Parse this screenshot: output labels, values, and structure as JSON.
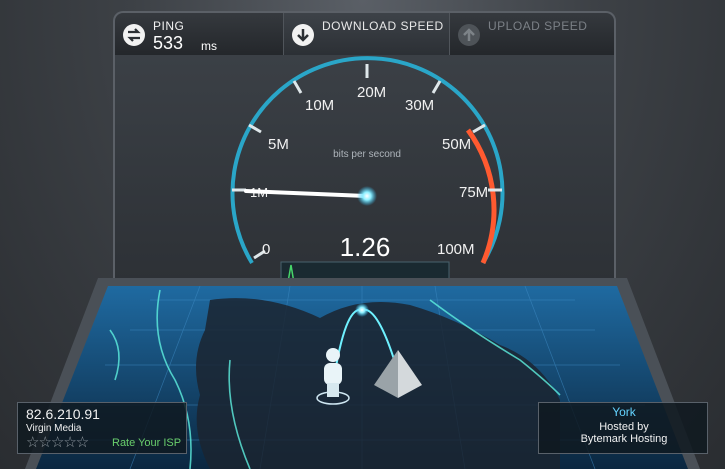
{
  "header": {
    "ping_label": "PING",
    "ping_value": "533",
    "ping_unit": "ms",
    "download_label": "DOWNLOAD SPEED",
    "upload_label": "UPLOAD SPEED"
  },
  "gauge": {
    "unit_label": "bits per second",
    "current_value": "1.26",
    "scale_labels": [
      "0",
      "1M",
      "5M",
      "10M",
      "20M",
      "30M",
      "50M",
      "75M",
      "100M"
    ]
  },
  "client": {
    "ip": "82.6.210.91",
    "isp": "Virgin Media",
    "rating_stars": "☆☆☆☆☆",
    "rate_link": "Rate Your ISP"
  },
  "server": {
    "city": "York",
    "hosted_by": "Hosted by",
    "host": "Bytemark Hosting"
  },
  "colors": {
    "accent": "#2ec6ff",
    "danger": "#ff5a30",
    "ok": "#69cf6c"
  }
}
